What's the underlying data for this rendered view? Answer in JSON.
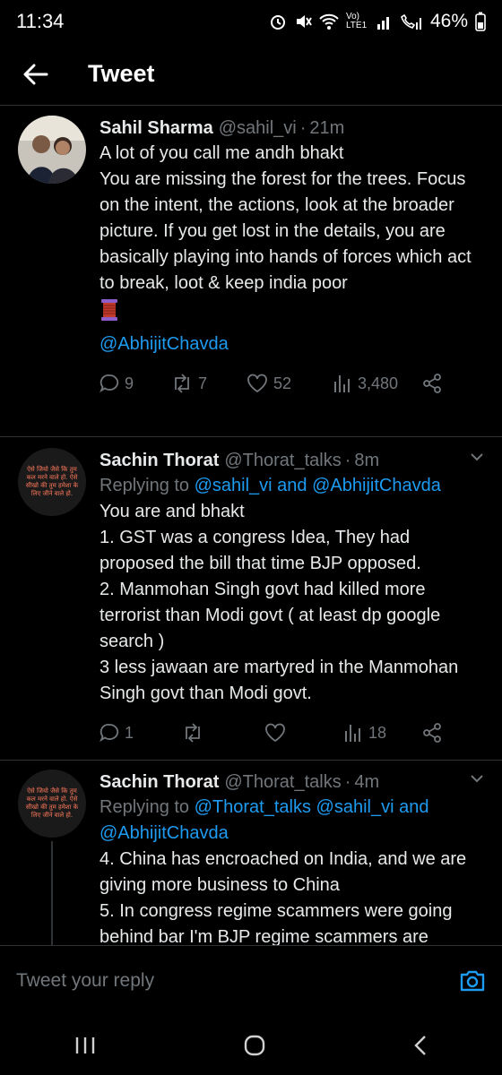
{
  "status": {
    "time": "11:34",
    "network": "Vo) LTE1",
    "battery": "46%"
  },
  "header": {
    "title": "Tweet"
  },
  "tweets": [
    {
      "name": "Sahil Sharma",
      "handle": "@sahil_vi",
      "time": "21m",
      "lines": [
        "A lot of you call me andh bhakt",
        "You are missing the forest for the trees. Focus on the intent, the actions, look at the broader picture. If you get lost in the details, you are basically playing into hands of forces which act to break, loot & keep india poor"
      ],
      "mention_line": "@AbhijitChavda",
      "replies": "9",
      "retweets": "7",
      "likes": "52",
      "views": "3,480"
    },
    {
      "name": "Sachin Thorat",
      "handle": "@Thorat_talks",
      "time": "8m",
      "replying_label": "Replying to",
      "replying_mentions": "@sahil_vi and @AbhijitChavda",
      "lines": [
        "You are and bhakt",
        "1. GST was a congress Idea, They had proposed the bill that time BJP opposed.",
        "2. Manmohan Singh govt had killed more terrorist than Modi govt ( at least dp google search )",
        "3 less jawaan are martyred in the Manmohan Singh govt than Modi govt."
      ],
      "replies": "1",
      "views": "18",
      "avatar_text": "ऐसे जियो जैसे कि तुम कल मरने वाले हो. ऐसे सीखो की तुम हमेशा के लिए जीने वाले हो."
    },
    {
      "name": "Sachin Thorat",
      "handle": "@Thorat_talks",
      "time": "4m",
      "replying_label": "Replying to",
      "replying_mentions": "@Thorat_talks @sahil_vi and @AbhijitChavda",
      "lines": [
        "4. China has encroached on India, and we are giving more business to China",
        "5. In congress regime scammers were going behind bar I'm BJP regime scammers are"
      ],
      "avatar_text": "ऐसे जियो जैसे कि तुम कल मरने वाले हो. ऐसे सीखो की तुम हमेशा के लिए जीने वाले हो."
    }
  ],
  "reply_bar": {
    "placeholder": "Tweet your reply"
  },
  "colors": {
    "accent": "#1d9bf0",
    "muted": "#71767b",
    "background": "#000000"
  }
}
